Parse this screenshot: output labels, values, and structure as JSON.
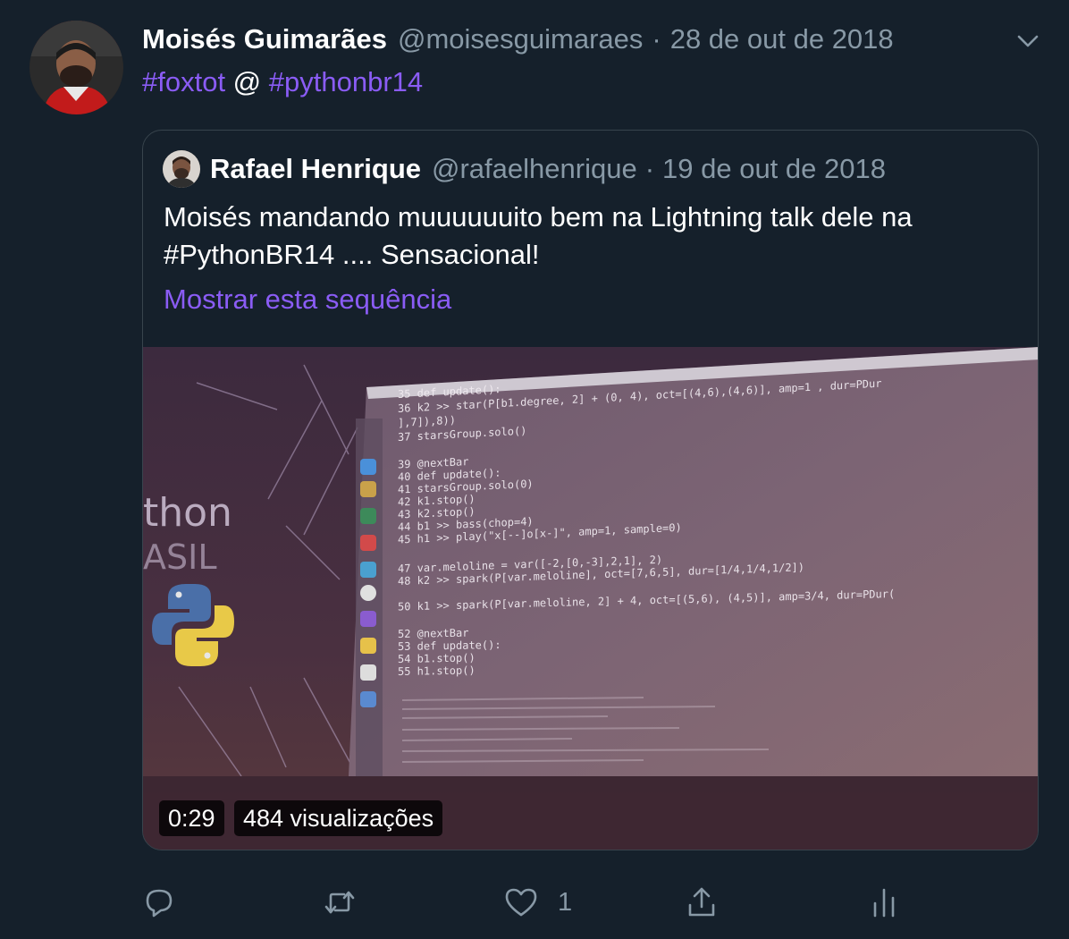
{
  "tweet": {
    "author_name": "Moisés Guimarães",
    "author_handle": "@moisesguimaraes",
    "separator": "·",
    "date": "28 de out de 2018",
    "text_parts": [
      {
        "text": "#foxtot",
        "type": "hashtag"
      },
      {
        "text": " @ ",
        "type": "plain"
      },
      {
        "text": "#pythonbr14",
        "type": "hashtag"
      }
    ]
  },
  "quoted": {
    "author_name": "Rafael Henrique",
    "author_handle": "@rafaelhenrique",
    "separator": "·",
    "date": "19 de out de 2018",
    "text": "Moisés mandando muuuuuuito bem na Lightning talk dele na #PythonBR14 .... Sensacional!",
    "show_thread": "Mostrar esta sequência",
    "video": {
      "duration": "0:29",
      "views": "484 visualizações",
      "screen_text": {
        "logo_partial": "thon",
        "logo_sub": "ASIL"
      }
    }
  },
  "actions": {
    "reply_icon": "reply-icon",
    "retweet_icon": "retweet-icon",
    "like_icon": "heart-icon",
    "like_count": "1",
    "share_icon": "share-icon",
    "analytics_icon": "analytics-icon"
  },
  "colors": {
    "background": "#15202b",
    "accent": "#8a5cf5",
    "secondary_text": "#8899a6",
    "border": "#38444d"
  }
}
